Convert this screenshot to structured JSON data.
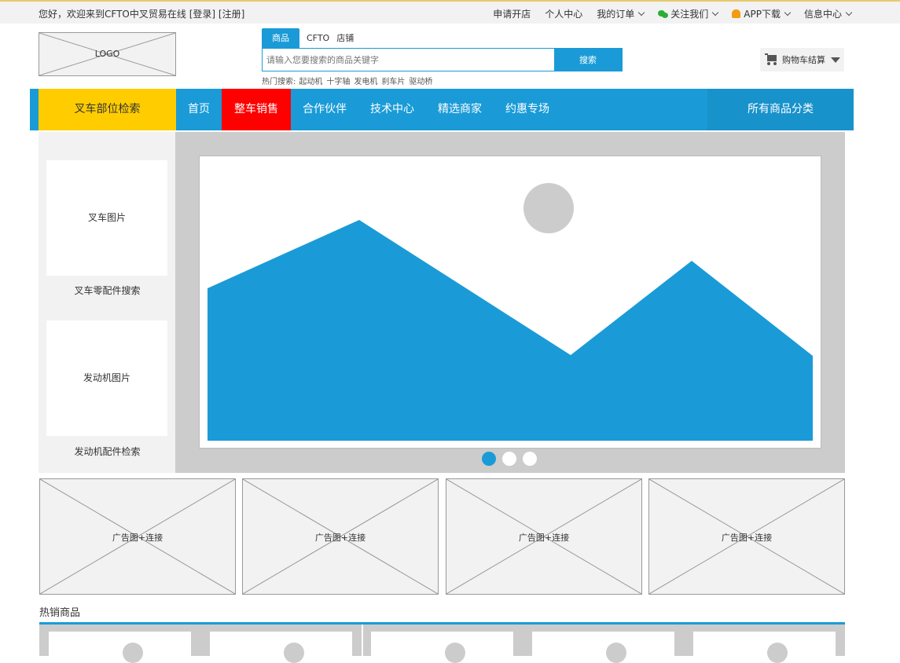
{
  "topbar": {
    "welcome": "您好，欢迎来到CFTO中叉贸易在线",
    "login": "[登录]",
    "register": "[注册]",
    "links": {
      "open_store": "申请开店",
      "personal_center": "个人中心",
      "my_orders": "我的订单",
      "follow_us": "关注我们",
      "app_download": "APP下载",
      "message_center": "信息中心"
    }
  },
  "logo": {
    "label": "LOGO"
  },
  "search": {
    "tabs": [
      "商品",
      "CFTO",
      "店铺"
    ],
    "placeholder": "请输入您要搜索的商品关键字",
    "button": "搜索",
    "hot_label": "热门搜索:",
    "hot_terms": [
      "起动机",
      "十字轴",
      "发电机",
      "刹车片",
      "驱动桥"
    ]
  },
  "cart": {
    "label": "购物车结算"
  },
  "mainnav": {
    "category_button": "叉车部位检索",
    "links": [
      "首页",
      "整车销售",
      "合作伙伴",
      "技术中心",
      "精选商家",
      "约惠专场"
    ],
    "all_categories": "所有商品分类"
  },
  "sidepanel": {
    "forklift_image": "叉车图片",
    "forklift_parts_search": "叉车零配件搜索",
    "engine_image": "发动机图片",
    "engine_parts_search": "发动机配件检索"
  },
  "carousel": {
    "active_index": 0,
    "slide_count": 3
  },
  "ads": [
    "广告图+连接",
    "广告图+连接",
    "广告图+连接",
    "广告图+连接"
  ],
  "hot_products": {
    "title": "热销商品"
  },
  "colors": {
    "brand_blue": "#1a9bd7",
    "category_yellow": "#ffcc00",
    "highlight_red": "#ff0000",
    "placeholder_gray": "#cccccc"
  }
}
